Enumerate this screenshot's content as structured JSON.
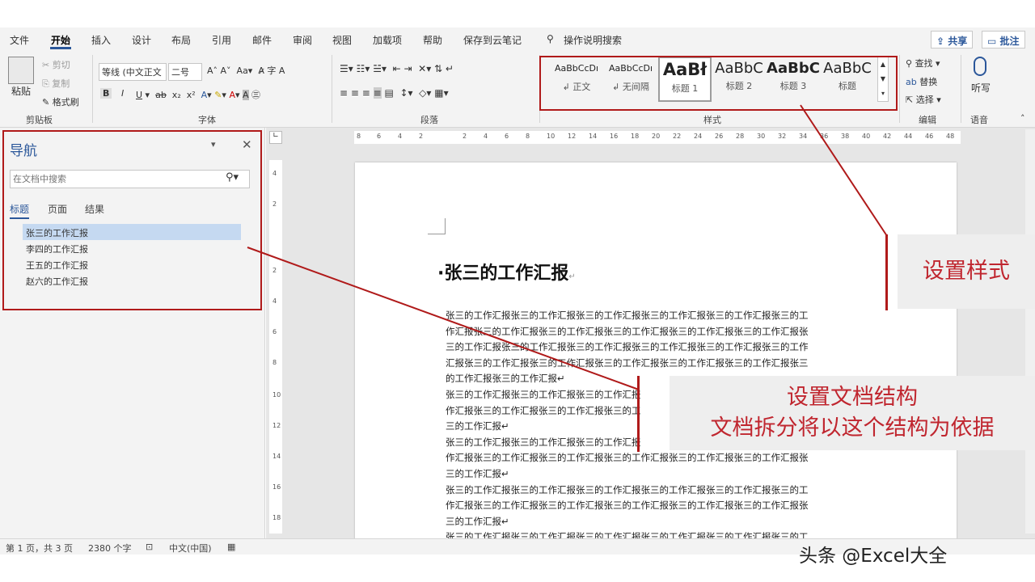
{
  "menu": {
    "tabs": [
      "文件",
      "开始",
      "插入",
      "设计",
      "布局",
      "引用",
      "邮件",
      "审阅",
      "视图",
      "加载项",
      "帮助",
      "保存到云笔记"
    ],
    "active_tab": "开始",
    "search_hint": "操作说明搜索",
    "share": "共享",
    "comments": "批注"
  },
  "ribbon": {
    "clipboard": {
      "paste": "粘贴",
      "cut": "剪切",
      "copy": "复制",
      "format_painter": "格式刷",
      "label": "剪贴板"
    },
    "font": {
      "font_name": "等线 (中文正文",
      "font_size": "二号",
      "label": "字体"
    },
    "paragraph": {
      "label": "段落"
    },
    "styles": {
      "label": "样式",
      "items": [
        {
          "preview": "AaBbCcDı",
          "name": "正文"
        },
        {
          "preview": "AaBbCcDı",
          "name": "无间隔"
        },
        {
          "preview": "AaBł",
          "name": "标题 1"
        },
        {
          "preview": "AaBbC",
          "name": "标题 2"
        },
        {
          "preview": "AaBbC",
          "name": "标题 3"
        },
        {
          "preview": "AaBbC",
          "name": "标题"
        }
      ]
    },
    "editing": {
      "find": "查找",
      "replace": "替换",
      "select": "选择",
      "label": "编辑"
    },
    "voice": {
      "dictate": "听写",
      "label": "语音"
    }
  },
  "nav": {
    "title": "导航",
    "search_placeholder": "在文档中搜索",
    "tabs": [
      "标题",
      "页面",
      "结果"
    ],
    "headings": [
      "张三的工作汇报",
      "李四的工作汇报",
      "王五的工作汇报",
      "赵六的工作汇报"
    ]
  },
  "ruler": {
    "h_numbers": [
      "8",
      "6",
      "4",
      "2",
      "2",
      "4",
      "6",
      "8",
      "10",
      "12",
      "14",
      "16",
      "18",
      "20",
      "22",
      "24",
      "26",
      "28",
      "30",
      "32",
      "34",
      "36",
      "38",
      "40",
      "42",
      "44",
      "46",
      "48"
    ],
    "v_numbers": [
      "4",
      "2",
      "2",
      "4",
      "6",
      "8",
      "10",
      "12",
      "14",
      "16",
      "18"
    ]
  },
  "document": {
    "heading": "张三的工作汇报",
    "lines": [
      "张三的工作汇报张三的工作汇报张三的工作汇报张三的工作汇报张三的工作汇报张三的工",
      "作汇报张三的工作汇报张三的工作汇报张三的工作汇报张三的工作汇报张三的工作汇报张",
      "三的工作汇报张三的工作汇报张三的工作汇报张三的工作汇报张三的工作汇报张三的工作",
      "汇报张三的工作汇报张三的工作汇报张三的工作汇报张三的工作汇报张三的工作汇报张三",
      "的工作汇报张三的工作汇报↵",
      "张三的工作汇报张三的工作汇报张三的工作汇报",
      "作汇报张三的工作汇报张三的工作汇报张三的工",
      "三的工作汇报↵",
      "张三的工作汇报张三的工作汇报张三的工作汇报",
      "作汇报张三的工作汇报张三的工作汇报张三的工作汇报张三的工作汇报张三的工作汇报张",
      "三的工作汇报↵",
      "张三的工作汇报张三的工作汇报张三的工作汇报张三的工作汇报张三的工作汇报张三的工",
      "作汇报张三的工作汇报张三的工作汇报张三的工作汇报张三的工作汇报张三的工作汇报张",
      "三的工作汇报↵",
      "张三的工作汇报张三的工作汇报张三的工作汇报张三的工作汇报张三的工作汇报张三的工"
    ]
  },
  "status": {
    "page": "第 1 页，共 3 页",
    "words": "2380 个字",
    "language": "中文(中国)"
  },
  "annotations": {
    "styles_note": "设置样式",
    "structure_note_line1": "设置文档结构",
    "structure_note_line2": "文档拆分将以这个结构为依据",
    "watermark": "头条 @Excel大全"
  },
  "colors": {
    "accent": "#2b579a",
    "annotation_red": "#b01a1a",
    "callout_text": "#c0262f",
    "selected_heading": "#c5d9f1"
  }
}
